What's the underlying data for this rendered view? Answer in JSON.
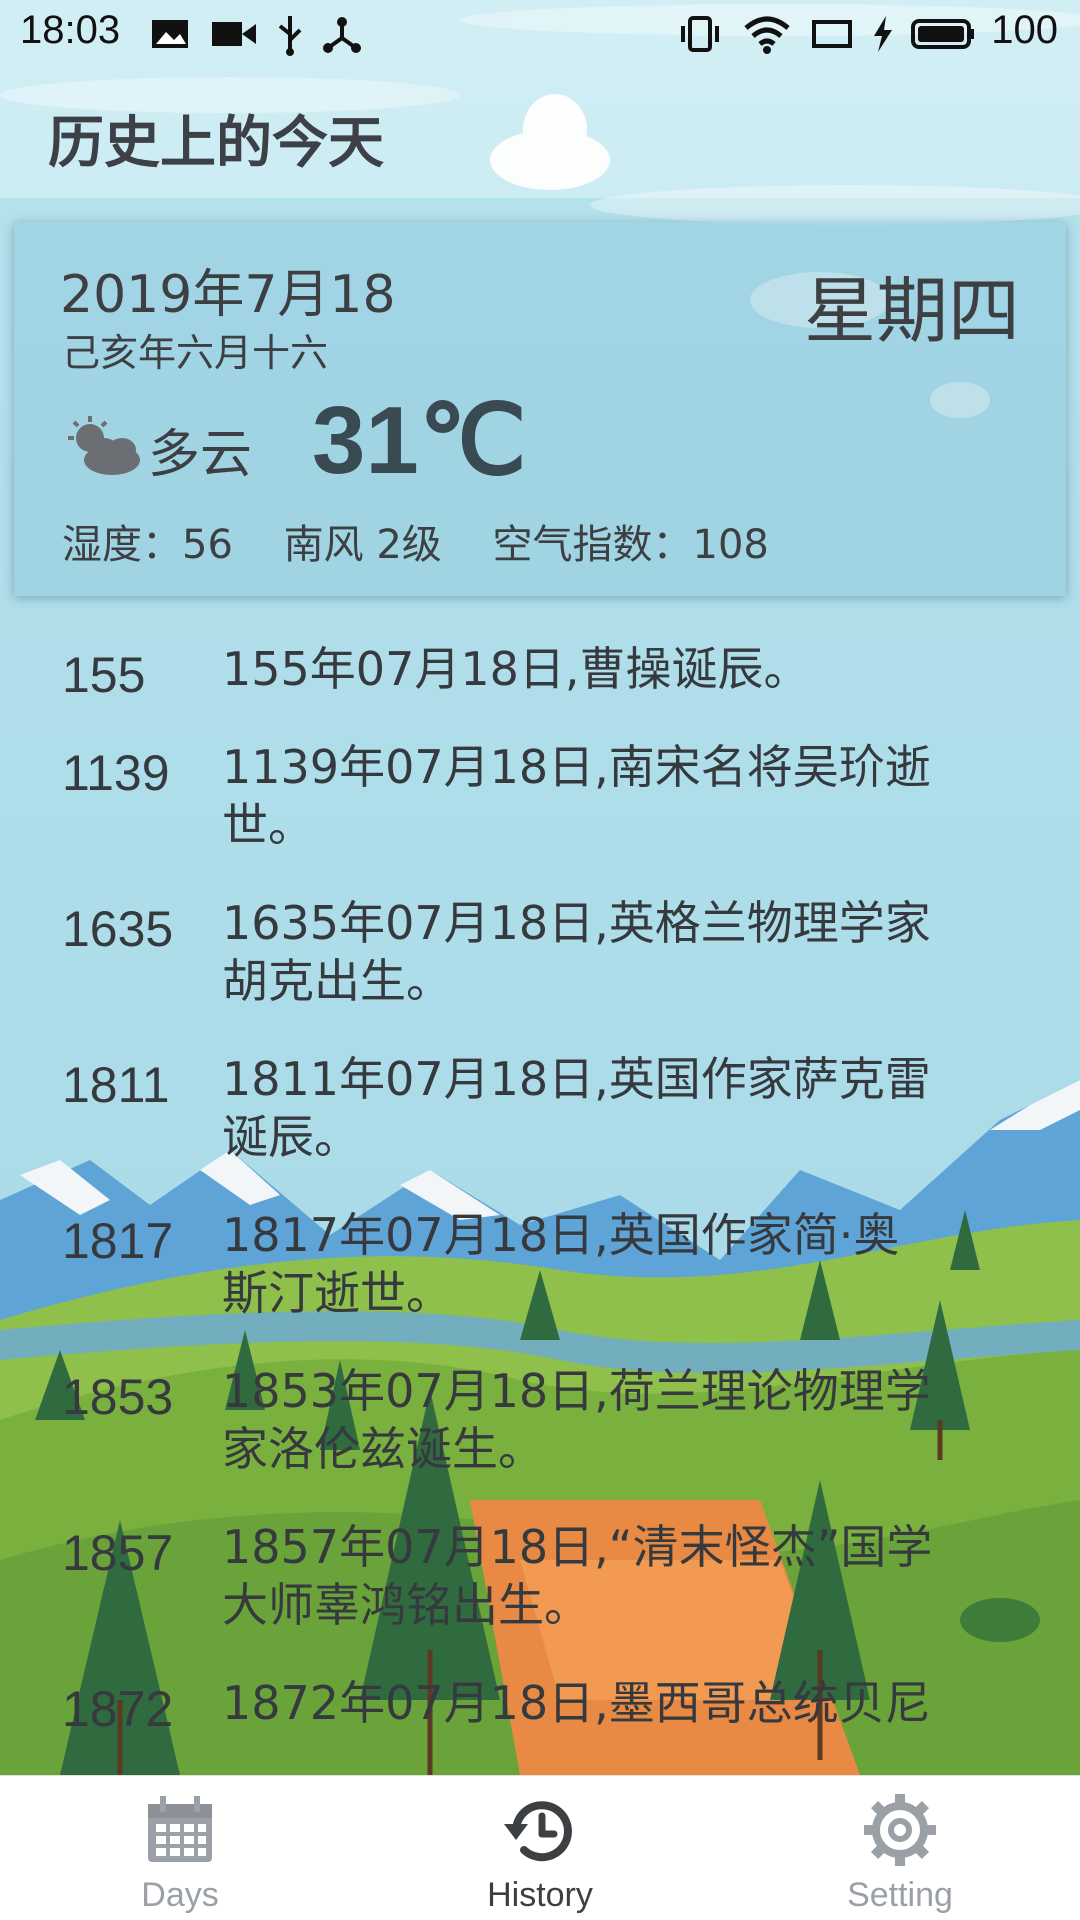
{
  "status_bar": {
    "time": "18:03",
    "battery": "100",
    "icons": [
      "image-icon",
      "video-icon",
      "usb-icon",
      "share-icon",
      "vibrate-icon",
      "wifi-icon",
      "screen-icon",
      "charging-icon",
      "battery-icon"
    ]
  },
  "header": {
    "title": "历史上的今天"
  },
  "weather_card": {
    "date": "2019年7月18",
    "lunar_date": "己亥年六月十六",
    "weekday": "星期四",
    "condition": "多云",
    "condition_icon": "partly-cloudy-icon",
    "temperature": "31℃",
    "humidity": "湿度：56",
    "wind": "南风 2级",
    "air_quality": "空气指数：108"
  },
  "history": {
    "events": [
      {
        "year": "155",
        "text": "155年07月18日,曹操诞辰。"
      },
      {
        "year": "1139",
        "text": "1139年07月18日,南宋名将吴玠逝世。"
      },
      {
        "year": "1635",
        "text": "1635年07月18日,英格兰物理学家胡克出生。"
      },
      {
        "year": "1811",
        "text": "1811年07月18日,英国作家萨克雷诞辰。"
      },
      {
        "year": "1817",
        "text": "1817年07月18日,英国作家简·奥斯汀逝世。"
      },
      {
        "year": "1853",
        "text": "1853年07月18日,荷兰理论物理学家洛伦兹诞生。"
      },
      {
        "year": "1857",
        "text": "1857年07月18日,“清末怪杰”国学大师辜鸿铭出生。"
      },
      {
        "year": "1872",
        "text": "1872年07月18日,墨西哥总统贝尼"
      }
    ]
  },
  "bottom_nav": {
    "items": [
      {
        "label": "Days",
        "icon": "calendar-icon",
        "active": false
      },
      {
        "label": "History",
        "icon": "history-icon",
        "active": true
      },
      {
        "label": "Setting",
        "icon": "gear-icon",
        "active": false
      }
    ]
  },
  "colors": {
    "sky": "#a9dbe9",
    "text": "#36393d",
    "nav_inactive": "#9aa0a6",
    "nav_active": "#3c4043"
  }
}
